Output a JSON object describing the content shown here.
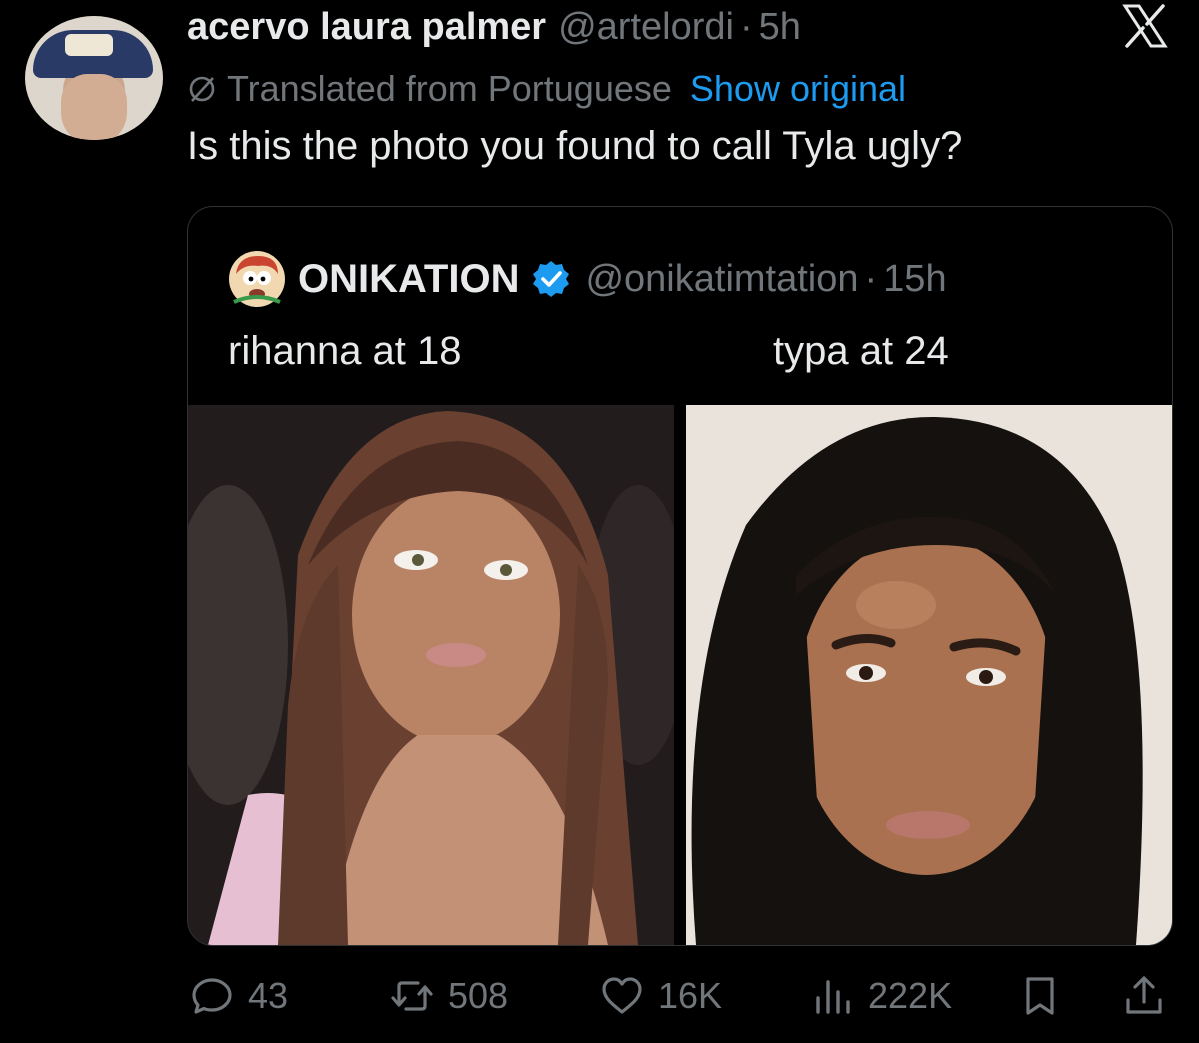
{
  "tweet": {
    "display_name": "acervo laura palmer",
    "handle": "@artelordi",
    "separator": "·",
    "time": "5h",
    "translated_label": "Translated from Portuguese",
    "show_original": "Show original",
    "text": "Is this the photo you found to call Tyla ugly?"
  },
  "quote": {
    "display_name": "ONIKATION",
    "handle": "@onikatimtation",
    "separator": "·",
    "time": "15h",
    "caption_left": "rihanna at 18",
    "caption_right": "typa at 24"
  },
  "actions": {
    "replies": "43",
    "reposts": "508",
    "likes": "16K",
    "views": "222K"
  },
  "icons": {
    "brand": "x-logo-icon",
    "translate": "translate-icon",
    "verified": "verified-badge-icon",
    "reply": "reply-icon",
    "repost": "repost-icon",
    "like": "heart-icon",
    "views": "views-icon",
    "bookmark": "bookmark-icon",
    "share": "share-icon"
  },
  "colors": {
    "background": "#000000",
    "text_primary": "#e7e9ea",
    "text_secondary": "#71767b",
    "link": "#1d9bf0",
    "verified": "#1d9bf0",
    "border": "#2f3336"
  }
}
